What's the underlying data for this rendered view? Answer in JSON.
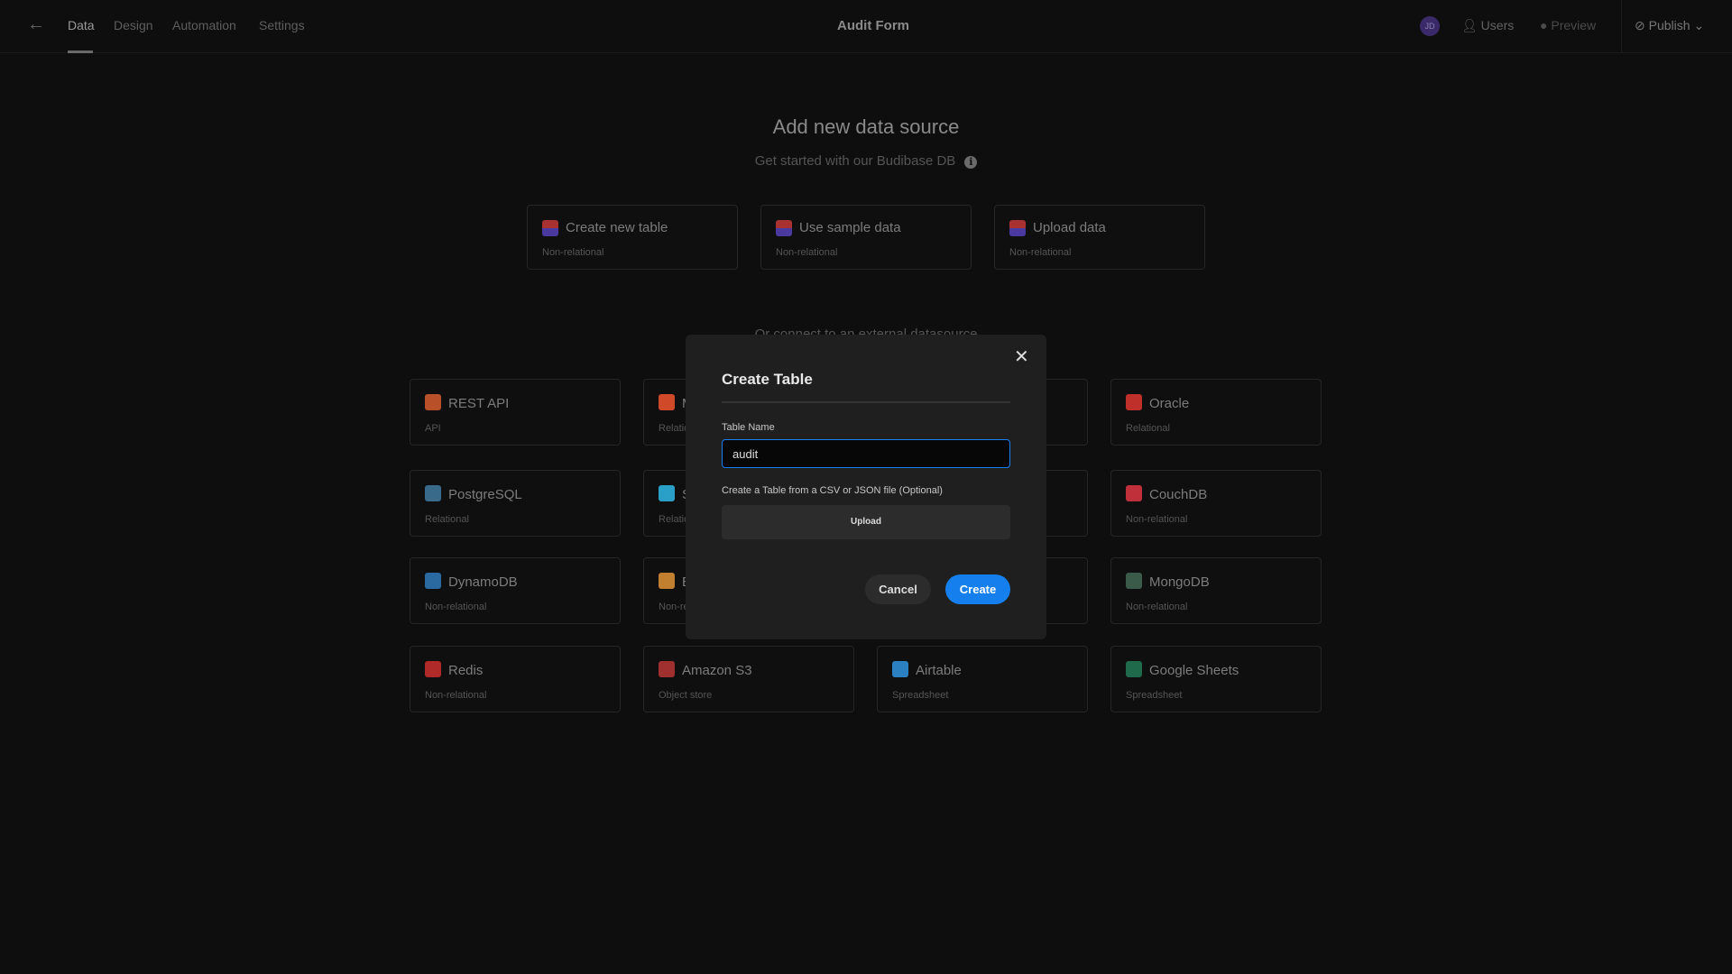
{
  "header": {
    "back_icon": "arrow-left-icon",
    "tabs": [
      {
        "label": "Data",
        "active": true
      },
      {
        "label": "Design"
      },
      {
        "label": "Automation"
      },
      {
        "label": "Settings"
      }
    ],
    "title": "Audit Form",
    "avatar": "JD",
    "users": "Users",
    "preview": "Preview",
    "publish": "Publish"
  },
  "main": {
    "title": "Add new data source",
    "subtitle": "Get started with our Budibase DB",
    "info_icon": "info-icon",
    "external_heading": "Or connect to an external datasource",
    "budibase_cards": [
      {
        "name": "Create new table",
        "desc": "Non-relational"
      },
      {
        "name": "Use sample data",
        "desc": "Non-relational"
      },
      {
        "name": "Upload data",
        "desc": "Non-relational"
      }
    ],
    "sources": [
      {
        "name": "REST API",
        "desc": "API",
        "color": "#b8502a"
      },
      {
        "name": "M",
        "desc": "Relational",
        "color": "#d04a2a"
      },
      {
        "name": "",
        "desc": "",
        "color": "#333"
      },
      {
        "name": "Oracle",
        "desc": "Relational",
        "color": "#c0302a"
      },
      {
        "name": "PostgreSQL",
        "desc": "Relational",
        "color": "#3a6a8a"
      },
      {
        "name": "S",
        "desc": "Relational",
        "color": "#2aa0c8"
      },
      {
        "name": "",
        "desc": "",
        "color": "#333"
      },
      {
        "name": "CouchDB",
        "desc": "Non-relational",
        "color": "#c0303a"
      },
      {
        "name": "DynamoDB",
        "desc": "Non-relational",
        "color": "#2a6aa0"
      },
      {
        "name": "E",
        "desc": "Non-relational",
        "color": "#c08030"
      },
      {
        "name": "",
        "desc": "",
        "color": "#333"
      },
      {
        "name": "MongoDB",
        "desc": "Non-relational",
        "color": "#3a5a4a"
      },
      {
        "name": "Redis",
        "desc": "Non-relational",
        "color": "#b02a2a"
      },
      {
        "name": "Amazon S3",
        "desc": "Object store",
        "color": "#a03030"
      },
      {
        "name": "Airtable",
        "desc": "Spreadsheet",
        "color": "#2a80c0"
      },
      {
        "name": "Google Sheets",
        "desc": "Spreadsheet",
        "color": "#1f6a4a"
      }
    ]
  },
  "modal": {
    "title": "Create Table",
    "close_icon": "close-icon",
    "table_name_label": "Table Name",
    "table_name_value": "audit",
    "file_label": "Create a Table from a CSV or JSON file (Optional)",
    "upload": "Upload",
    "cancel": "Cancel",
    "create": "Create",
    "accent": "#1580ed"
  }
}
